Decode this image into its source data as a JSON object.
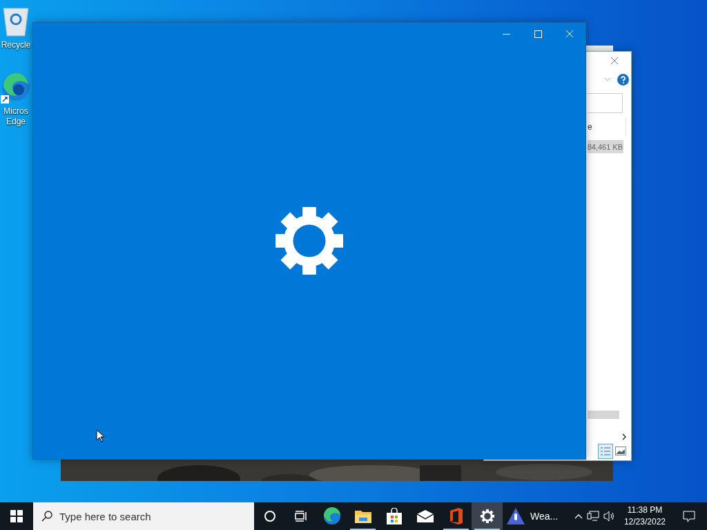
{
  "desktop_icons": [
    {
      "kind": "recycle",
      "lines": [
        "Recycle"
      ]
    },
    {
      "kind": "edge",
      "lines": [
        "Micros",
        "Edge"
      ]
    }
  ],
  "background_window": {
    "header": "e",
    "cell": "84,461 KB"
  },
  "taskbar": {
    "search": {
      "placeholder": "Type here to search"
    },
    "apps": [
      {
        "kind": "cortana",
        "running": false,
        "selected": false
      },
      {
        "kind": "taskview",
        "running": false,
        "selected": false
      },
      {
        "kind": "edge",
        "running": false,
        "selected": false
      },
      {
        "kind": "folder",
        "running": true,
        "selected": false
      },
      {
        "kind": "store",
        "running": false,
        "selected": false
      },
      {
        "kind": "mail",
        "running": false,
        "selected": false
      },
      {
        "kind": "office",
        "running": true,
        "selected": false
      },
      {
        "kind": "settings",
        "running": true,
        "selected": true
      }
    ],
    "weather": "Wea...",
    "clock": {
      "time": "11:38 PM",
      "date": "12/23/2022"
    }
  }
}
